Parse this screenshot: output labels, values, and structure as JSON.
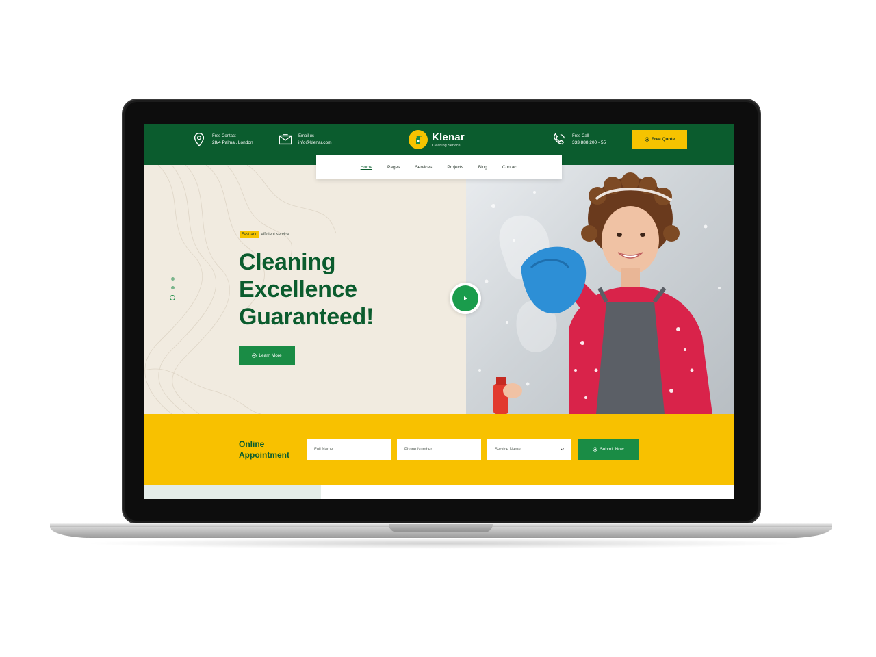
{
  "topbar": {
    "address": {
      "label": "Free Contact",
      "value": "28/4 Palmal, London",
      "icon": "location-pin-icon"
    },
    "email": {
      "label": "Email us",
      "value": "info@klenar.com",
      "icon": "envelope-icon"
    },
    "phone": {
      "label": "Free Call",
      "value": "333 888 200 - 55",
      "icon": "phone-icon"
    },
    "brand": {
      "name": "Klenar",
      "tagline": "Cleaning Service"
    },
    "quote_label": "Free Quote"
  },
  "nav": {
    "items": [
      {
        "label": "Home",
        "active": true
      },
      {
        "label": "Pages",
        "active": false
      },
      {
        "label": "Services",
        "active": false
      },
      {
        "label": "Projects",
        "active": false
      },
      {
        "label": "Blog",
        "active": false
      },
      {
        "label": "Contact",
        "active": false
      }
    ]
  },
  "hero": {
    "badge_highlight": "Fast and",
    "badge_rest": "efficient service",
    "title_lines": [
      "Cleaning",
      "Excellence",
      "Guaranteed!"
    ],
    "cta_label": "Learn More"
  },
  "appointment": {
    "title_line1": "Online",
    "title_line2": "Appointment",
    "full_name_placeholder": "Full Name",
    "phone_placeholder": "Phone Number",
    "service_placeholder": "Service Name",
    "submit_label": "Submit Now"
  },
  "colors": {
    "brand_green": "#0b5c2e",
    "accent_green": "#1a8c45",
    "accent_yellow": "#f6c300",
    "hero_bg": "#f1ebe0"
  }
}
